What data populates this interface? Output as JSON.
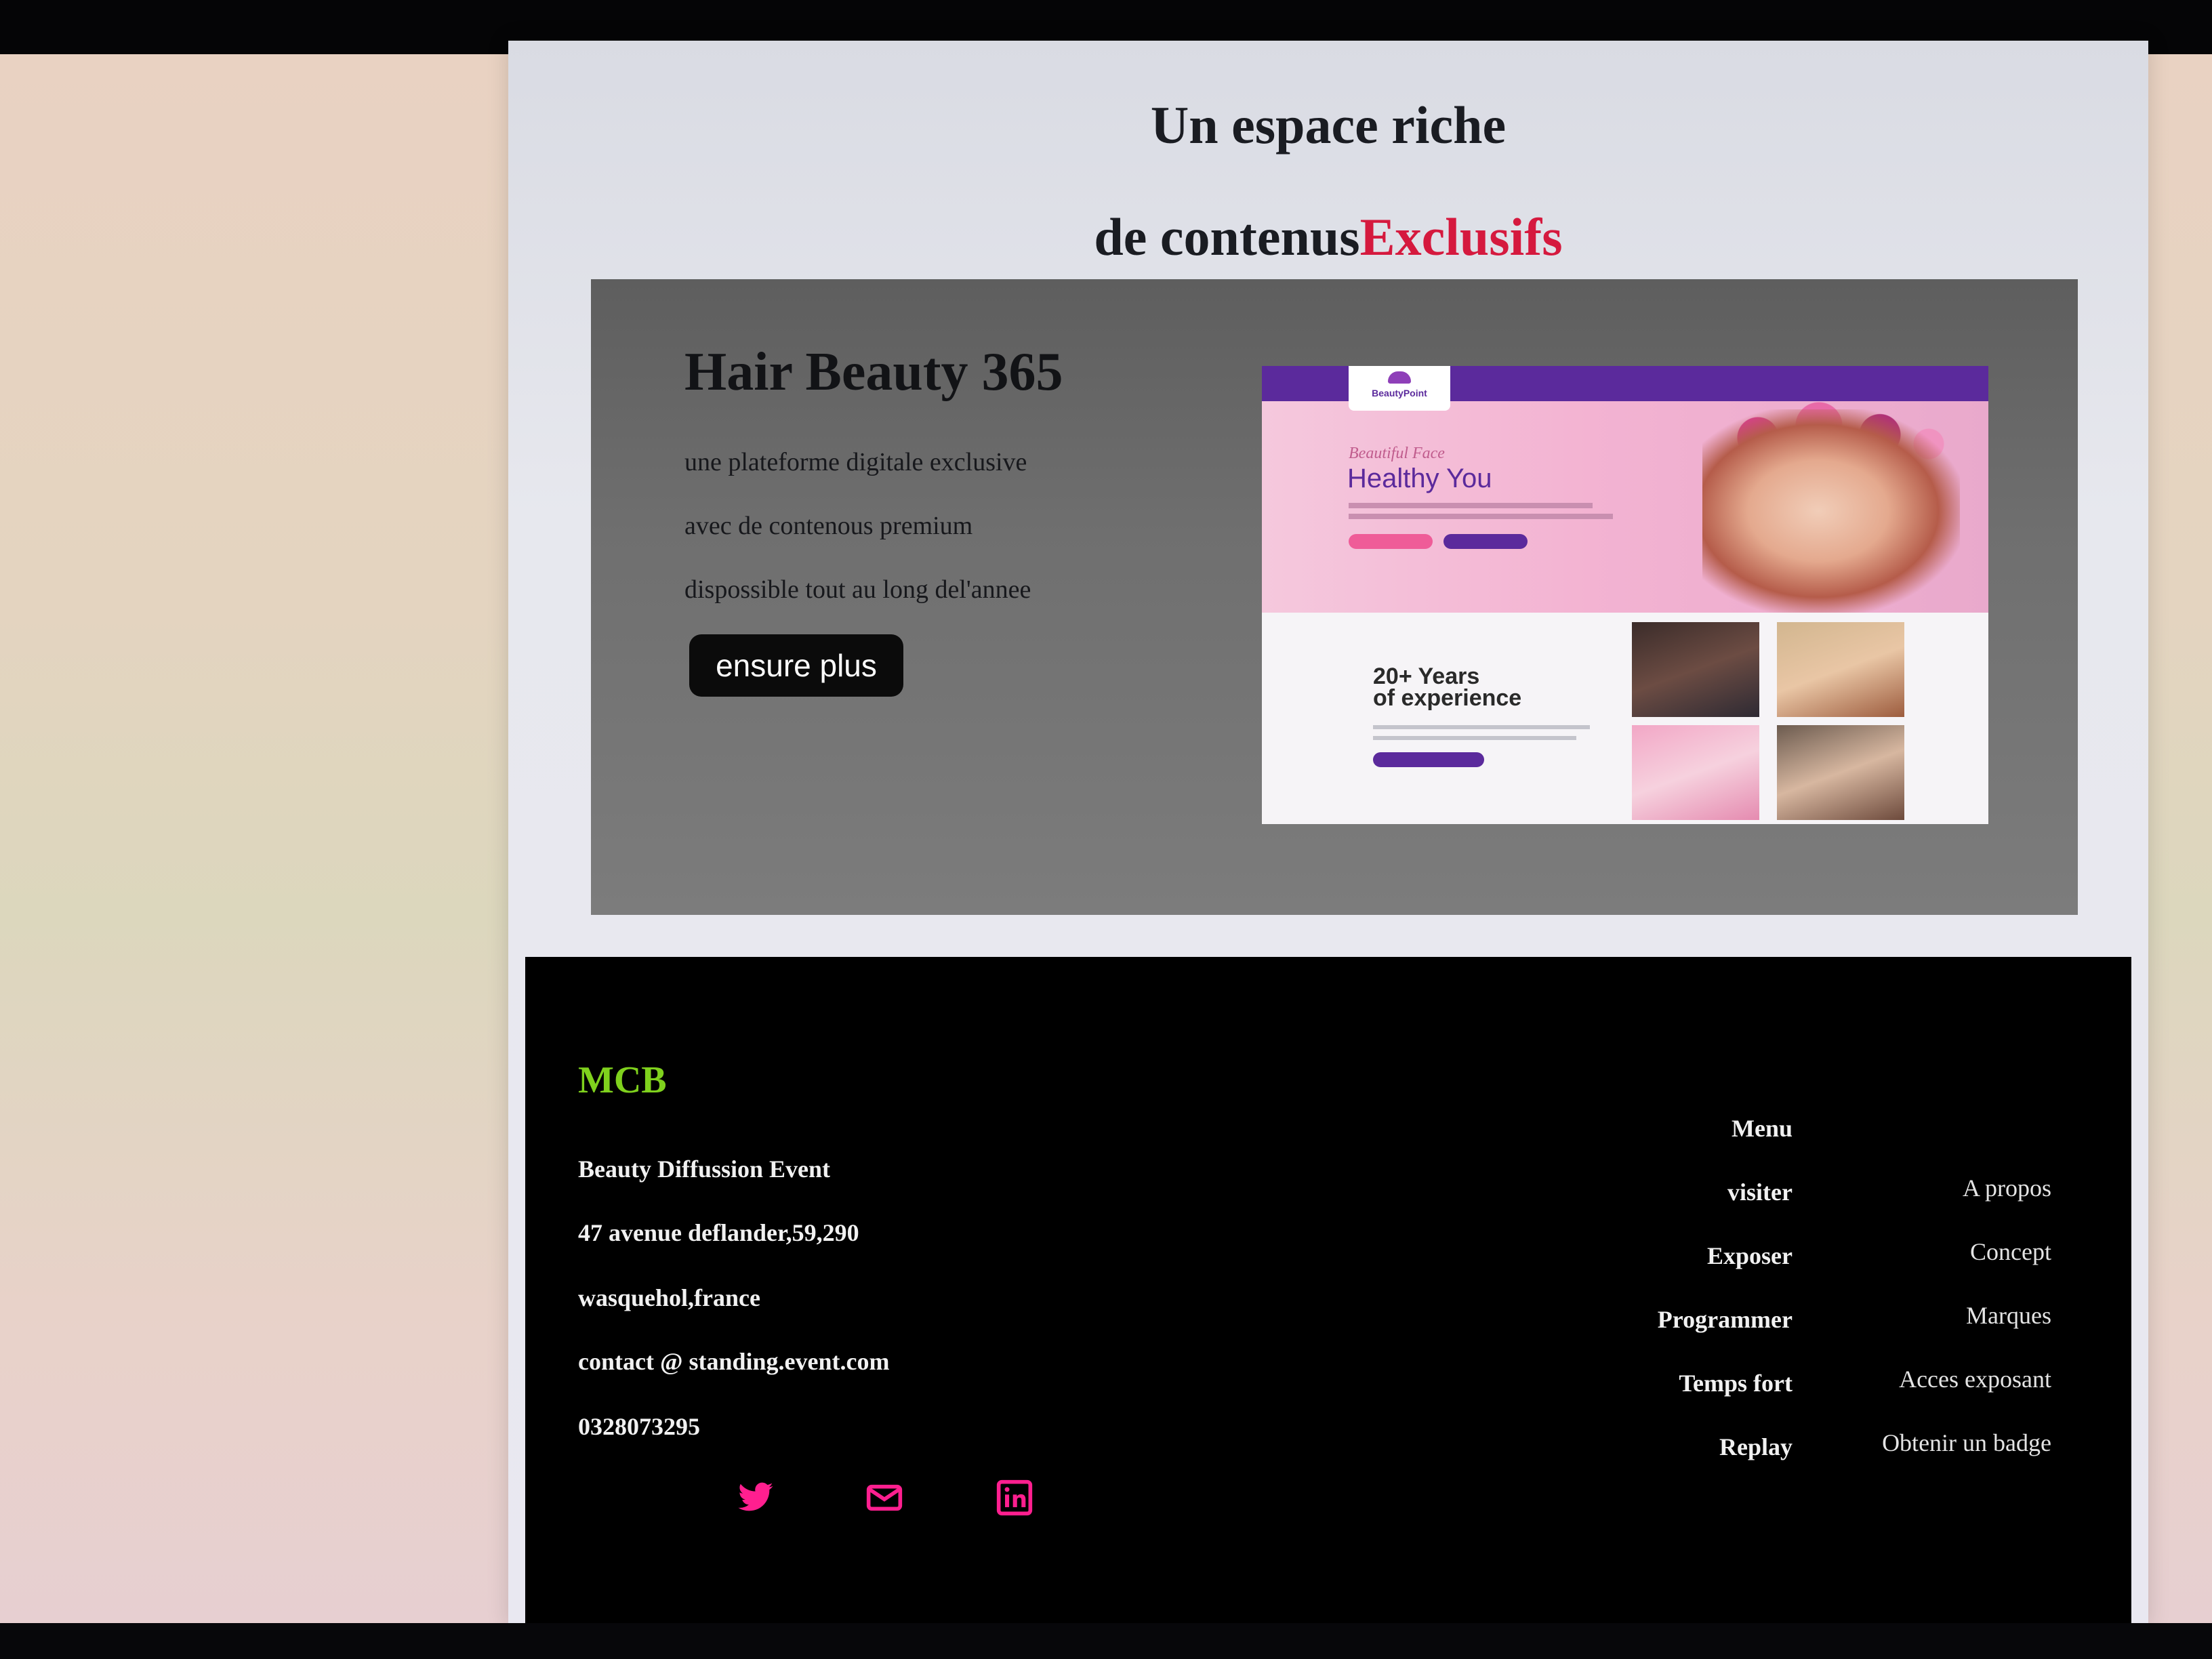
{
  "heading": {
    "line1": "Un espace riche",
    "line2_prefix": "de contenus",
    "line2_accent": "Exclusifs"
  },
  "hero": {
    "title": "Hair Beauty 365",
    "lines": [
      "une plateforme digitale exclusive",
      "avec de contenous premium",
      "dispossible tout au long del'annee"
    ],
    "button": "ensure plus",
    "preview": {
      "logo": "BeautyPoint",
      "script": "Beautiful Face",
      "title": "Healthy You",
      "years": [
        "20+ Years",
        "of experience"
      ]
    }
  },
  "footer": {
    "brand": "MCB",
    "info": [
      "Beauty Diffussion Event",
      "47 avenue deflander,59,290",
      "wasquehol,france",
      "contact @ standing.event.com",
      "0328073295"
    ],
    "menu_title": "Menu",
    "menu": [
      "visiter",
      "Exposer",
      "Programmer",
      "Temps fort",
      "Replay"
    ],
    "links": [
      "A propos",
      "Concept",
      "Marques",
      "Acces exposant",
      "Obtenir un badge"
    ],
    "social": [
      "twitter-icon",
      "mail-icon",
      "linkedin-icon"
    ],
    "colors": {
      "brand": "#7fd11d",
      "social": "#ff1f8f",
      "accent": "#d5193e"
    }
  }
}
